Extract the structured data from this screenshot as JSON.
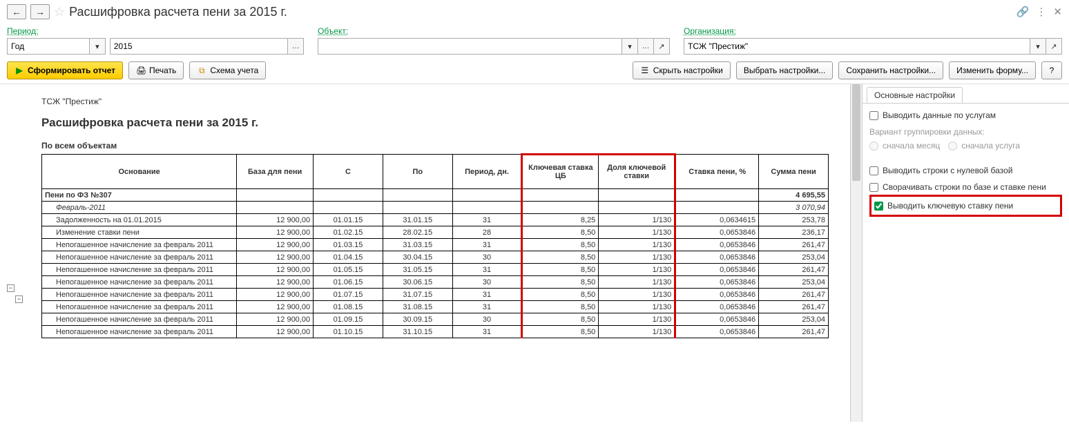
{
  "title": "Расшифровка расчета пени  за 2015 г.",
  "filters": {
    "period_label": "Период:",
    "period_type": "Год",
    "period_year": "2015",
    "object_label": "Объект:",
    "object_value": "",
    "org_label": "Организация:",
    "org_value": "ТСЖ \"Престиж\""
  },
  "toolbar": {
    "generate": "Сформировать отчет",
    "print": "Печать",
    "scheme": "Схема учета",
    "hide_settings": "Скрыть настройки",
    "choose_settings": "Выбрать настройки...",
    "save_settings": "Сохранить настройки...",
    "edit_form": "Изменить форму...",
    "help": "?"
  },
  "report": {
    "org": "ТСЖ \"Престиж\"",
    "title": "Расшифровка расчета пени за 2015 г.",
    "subtitle": "По всем объектам",
    "columns": [
      "Основание",
      "База для пени",
      "С",
      "По",
      "Период, дн.",
      "Ключевая ставка ЦБ",
      "Доля ключевой ставки",
      "Ставка пени, %",
      "Сумма пени"
    ],
    "section": {
      "name": "Пени по ФЗ №307",
      "sum": "4 695,55"
    },
    "subsection": {
      "name": "Февраль-2011",
      "sum": "3 070,94"
    },
    "rows": [
      {
        "name": "Задолженность на 01.01.2015",
        "base": "12 900,00",
        "from": "01.01.15",
        "to": "31.01.15",
        "days": "31",
        "rate": "8,25",
        "frac": "1/130",
        "pct": "0,0634615",
        "sum": "253,78"
      },
      {
        "name": "Изменение ставки пени",
        "base": "12 900,00",
        "from": "01.02.15",
        "to": "28.02.15",
        "days": "28",
        "rate": "8,50",
        "frac": "1/130",
        "pct": "0,0653846",
        "sum": "236,17"
      },
      {
        "name": "Непогашенное начисление за февраль 2011",
        "base": "12 900,00",
        "from": "01.03.15",
        "to": "31.03.15",
        "days": "31",
        "rate": "8,50",
        "frac": "1/130",
        "pct": "0,0653846",
        "sum": "261,47"
      },
      {
        "name": "Непогашенное начисление за февраль 2011",
        "base": "12 900,00",
        "from": "01.04.15",
        "to": "30.04.15",
        "days": "30",
        "rate": "8,50",
        "frac": "1/130",
        "pct": "0,0653846",
        "sum": "253,04"
      },
      {
        "name": "Непогашенное начисление за февраль 2011",
        "base": "12 900,00",
        "from": "01.05.15",
        "to": "31.05.15",
        "days": "31",
        "rate": "8,50",
        "frac": "1/130",
        "pct": "0,0653846",
        "sum": "261,47"
      },
      {
        "name": "Непогашенное начисление за февраль 2011",
        "base": "12 900,00",
        "from": "01.06.15",
        "to": "30.06.15",
        "days": "30",
        "rate": "8,50",
        "frac": "1/130",
        "pct": "0,0653846",
        "sum": "253,04"
      },
      {
        "name": "Непогашенное начисление за февраль 2011",
        "base": "12 900,00",
        "from": "01.07.15",
        "to": "31.07.15",
        "days": "31",
        "rate": "8,50",
        "frac": "1/130",
        "pct": "0,0653846",
        "sum": "261,47"
      },
      {
        "name": "Непогашенное начисление за февраль 2011",
        "base": "12 900,00",
        "from": "01.08.15",
        "to": "31.08.15",
        "days": "31",
        "rate": "8,50",
        "frac": "1/130",
        "pct": "0,0653846",
        "sum": "261,47"
      },
      {
        "name": "Непогашенное начисление за февраль 2011",
        "base": "12 900,00",
        "from": "01.09.15",
        "to": "30.09.15",
        "days": "30",
        "rate": "8,50",
        "frac": "1/130",
        "pct": "0,0653846",
        "sum": "253,04"
      },
      {
        "name": "Непогашенное начисление за февраль 2011",
        "base": "12 900,00",
        "from": "01.10.15",
        "to": "31.10.15",
        "days": "31",
        "rate": "8,50",
        "frac": "1/130",
        "pct": "0,0653846",
        "sum": "261,47"
      }
    ]
  },
  "settings": {
    "tab": "Основные настройки",
    "by_services": "Выводить данные по услугам",
    "group_label": "Вариант группировки данных:",
    "r1": "сначала месяц",
    "r2": "сначала услуга",
    "zero_base": "Выводить строки с нулевой базой",
    "collapse": "Сворачивать строки по базе и ставке пени",
    "key_rate": "Выводить ключевую ставку пени"
  }
}
